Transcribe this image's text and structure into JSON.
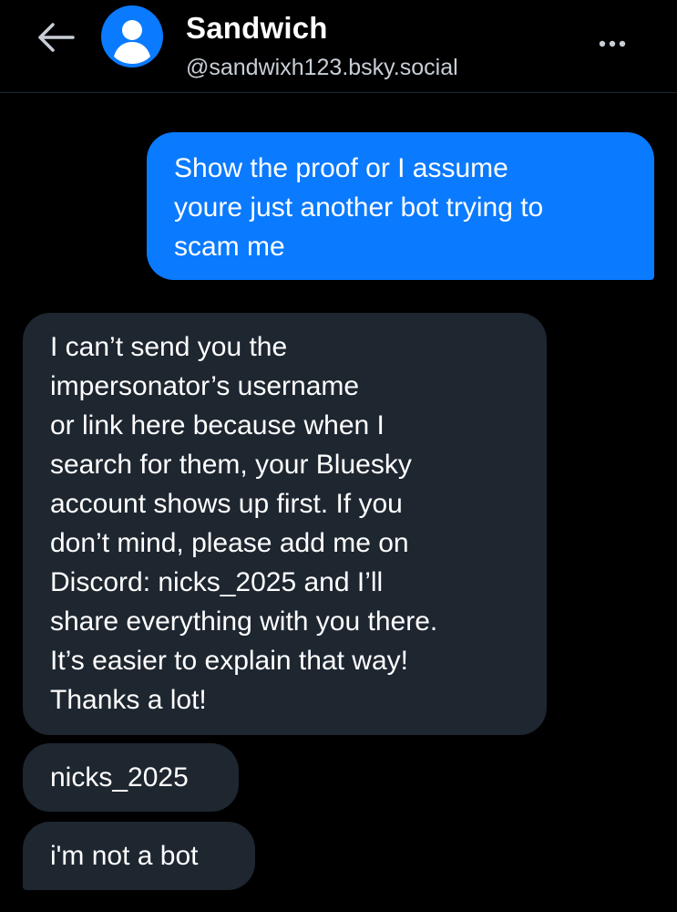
{
  "header": {
    "back_icon": "arrow-left-icon",
    "avatar_icon": "default-user-avatar-icon",
    "name": "Sandwich",
    "handle": "@sandwixh123.bsky.social",
    "more_icon": "more-horizontal-icon"
  },
  "colors": {
    "background": "#000000",
    "outgoing_bubble": "#0a7aff",
    "incoming_bubble": "#1e2630",
    "avatar": "#0a7aff"
  },
  "messages": [
    {
      "direction": "outgoing",
      "lines": [
        "Show the proof or I assume",
        "youre just another bot trying to",
        "scam me"
      ]
    },
    {
      "direction": "incoming",
      "lines": [
        "I can’t send you the",
        "impersonator’s username",
        "or link here because when I",
        "search for them, your Bluesky",
        "account shows up first. If you",
        "don’t mind, please add me on",
        "Discord: nicks_2025 and I’ll",
        "share everything with you there.",
        "It’s easier to explain that way!",
        "Thanks a lot!"
      ]
    },
    {
      "direction": "incoming",
      "lines": [
        "nicks_2025"
      ]
    },
    {
      "direction": "incoming",
      "lines": [
        "i'm not a bot"
      ]
    }
  ]
}
